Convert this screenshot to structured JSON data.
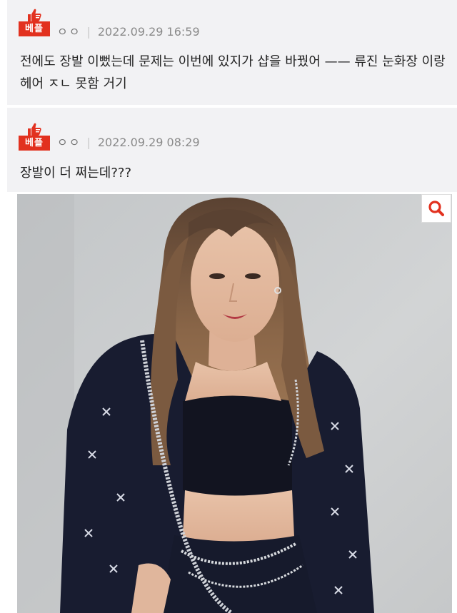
{
  "comments": [
    {
      "badge": "베플",
      "author": "ㅇㅇ",
      "separator": "|",
      "date": "2022.09.29 16:59",
      "text": "전에도 장발 이뻤는데 문제는 이번에 있지가 샵을 바꿨어 —— 류진 눈화장 이랑 헤어 ㅈㄴ 못함 거기"
    },
    {
      "badge": "베플",
      "author": "ㅇㅇ",
      "separator": "|",
      "date": "2022.09.29 08:29",
      "text": "장발이 더 쩌는데???"
    }
  ],
  "colors": {
    "badge_red": "#e2311f",
    "comment_bg": "#f2f2f4",
    "zoom_icon": "#e2311f"
  },
  "icons": [
    "thumbs-up-icon",
    "search-icon"
  ]
}
